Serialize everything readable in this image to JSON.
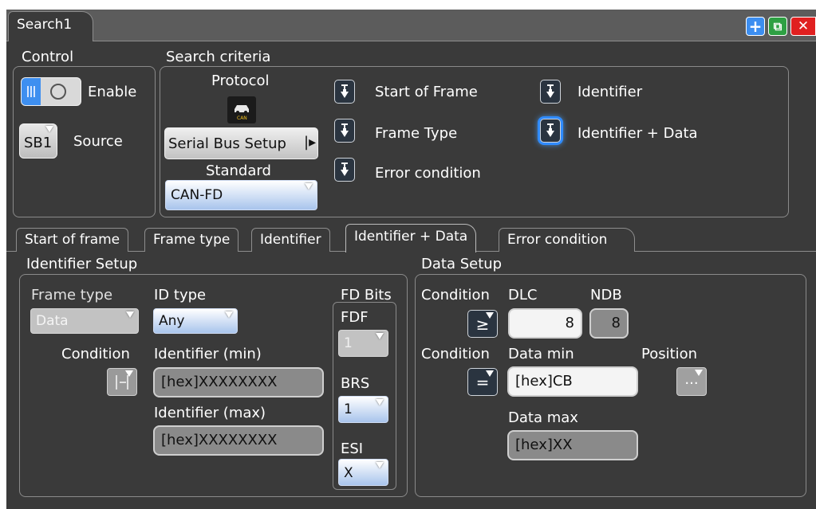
{
  "window": {
    "title": "Search1",
    "buttons": {
      "add": "+",
      "copy": "⧉",
      "close": "✕"
    }
  },
  "control": {
    "heading": "Control",
    "enable_label": "Enable",
    "source_value": "SB1",
    "source_label": "Source"
  },
  "criteria": {
    "heading": "Search criteria",
    "protocol_label": "Protocol",
    "protocol_icon_text": "CAN",
    "serial_bus_setup": "Serial Bus Setup",
    "standard_label": "Standard",
    "standard_value": "CAN-FD",
    "options": {
      "start_of_frame": "Start of Frame",
      "frame_type": "Frame Type",
      "error_condition": "Error condition",
      "identifier": "Identifier",
      "identifier_data": "Identifier + Data"
    },
    "selected_option": "Identifier + Data"
  },
  "tabs": [
    "Start of frame",
    "Frame type",
    "Identifier",
    "Identifier + Data",
    "Error condition"
  ],
  "active_tab": "Identifier + Data",
  "identifier_setup": {
    "heading": "Identifier Setup",
    "frame_type_label": "Frame type",
    "frame_type_value": "Data",
    "id_type_label": "ID type",
    "id_type_value": "Any",
    "condition_label": "Condition",
    "identifier_min_label": "Identifier (min)",
    "identifier_min_value": "[hex]XXXXXXXX",
    "identifier_max_label": "Identifier (max)",
    "identifier_max_value": "[hex]XXXXXXXX",
    "fd_bits_label": "FD Bits",
    "fdf_label": "FDF",
    "fdf_value": "1",
    "brs_label": "BRS",
    "brs_value": "1",
    "esi_label": "ESI",
    "esi_value": "X"
  },
  "data_setup": {
    "heading": "Data Setup",
    "condition1_label": "Condition",
    "condition1_value": "≥",
    "dlc_label": "DLC",
    "dlc_value": "8",
    "ndb_label": "NDB",
    "ndb_value": "8",
    "condition2_label": "Condition",
    "condition2_value": "=",
    "data_min_label": "Data min",
    "data_min_value": "[hex]CB",
    "position_label": "Position",
    "position_value": "...",
    "data_max_label": "Data max",
    "data_max_value": "[hex]XX"
  }
}
